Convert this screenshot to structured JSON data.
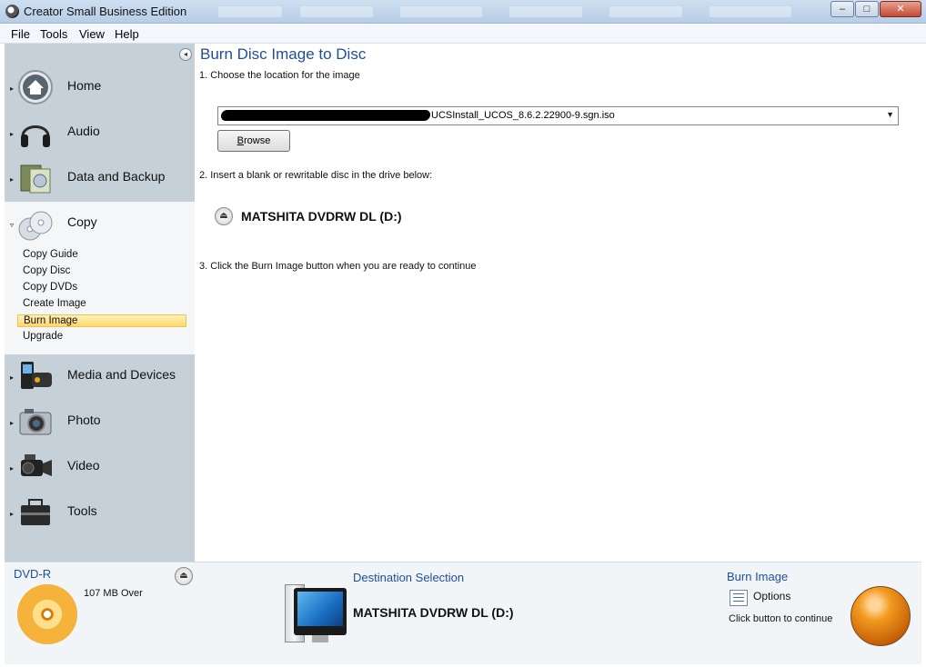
{
  "window": {
    "title": "Creator Small Business Edition",
    "minimize": "–",
    "maximize": "□",
    "close": "✕"
  },
  "menu": [
    "File",
    "Tools",
    "View",
    "Help"
  ],
  "sidebar": {
    "collapse_glyph": "◂",
    "items": [
      {
        "label": "Home",
        "icon": "home-icon"
      },
      {
        "label": "Audio",
        "icon": "headphones-icon"
      },
      {
        "label": "Data and Backup",
        "icon": "data-backup-icon"
      },
      {
        "label": "Copy",
        "icon": "copy-discs-icon"
      },
      {
        "label": "Media and Devices",
        "icon": "media-devices-icon"
      },
      {
        "label": "Photo",
        "icon": "camera-icon"
      },
      {
        "label": "Video",
        "icon": "video-camera-icon"
      },
      {
        "label": "Tools",
        "icon": "toolbox-icon"
      }
    ],
    "copy_subitems": [
      "Copy Guide",
      "Copy Disc",
      "Copy DVDs",
      "Create Image",
      "Burn Image",
      "Upgrade"
    ],
    "selected_subitem": "Burn Image"
  },
  "main": {
    "title": "Burn Disc Image to Disc",
    "step1": "1. Choose the location for the image",
    "image_path": "UCSInstall_UCOS_8.6.2.22900-9.sgn.iso",
    "combo_arrow": "▼",
    "browse_label": "Browse",
    "step2": "2. Insert a blank or rewritable disc in the drive below:",
    "drive": "MATSHITA DVDRW DL (D:)",
    "eject_glyph": "⏏",
    "step3": "3. Click the Burn Image button when you are ready to continue"
  },
  "bottom": {
    "disc_type": "DVD-R",
    "capacity_status": "107 MB Over",
    "eject_glyph": "⏏",
    "destination_heading": "Destination Selection",
    "destination_drive": "MATSHITA DVDRW DL (D:)",
    "burn_heading": "Burn Image",
    "options_label": "Options",
    "burn_hint": "Click button to continue"
  },
  "colors": {
    "accent_blue": "#1d4f9a",
    "sidebar_bg": "#c5d0d8",
    "selection": "#ffd86d",
    "burn_orange": "#f29a1f"
  }
}
